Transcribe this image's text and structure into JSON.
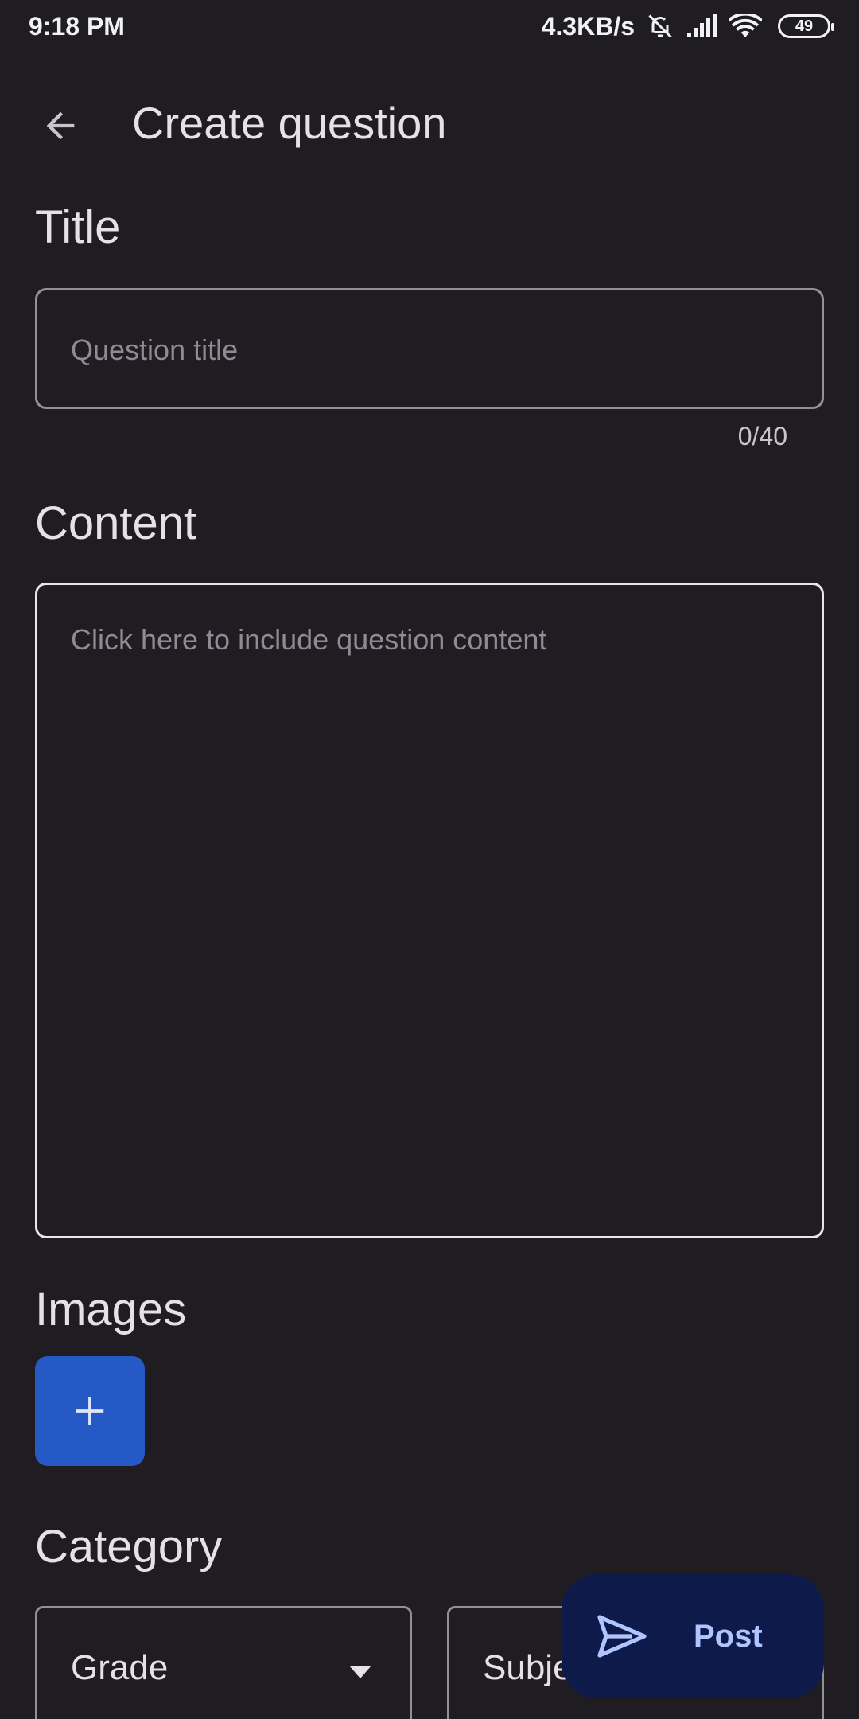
{
  "status_bar": {
    "time": "9:18 PM",
    "net_speed": "4.3KB/s",
    "battery": "49"
  },
  "appbar": {
    "title": "Create question"
  },
  "title_section": {
    "label": "Title",
    "placeholder": "Question title",
    "counter": "0/40"
  },
  "content_section": {
    "label": "Content",
    "placeholder": "Click here to include question content"
  },
  "images_section": {
    "label": "Images"
  },
  "category_section": {
    "label": "Category",
    "grade_label": "Grade",
    "subject_label": "Subject"
  },
  "fab": {
    "label": "Post"
  },
  "colors": {
    "background": "#1f1d22",
    "accent": "#2459c6",
    "fab_background": "#0e1a4a",
    "fab_text": "#b0c5ff"
  },
  "icons": [
    "back-arrow-icon",
    "muted-bell-icon",
    "signal-icon",
    "wifi-icon",
    "battery-icon",
    "plus-icon",
    "dropdown-arrow-icon",
    "send-icon"
  ]
}
